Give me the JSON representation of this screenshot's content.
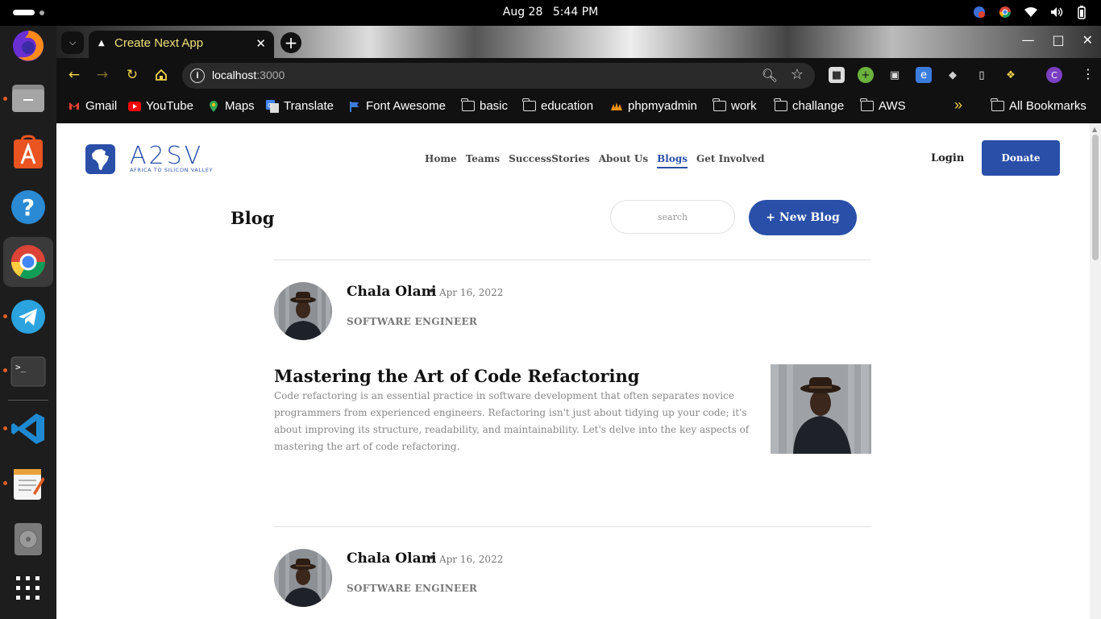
{
  "system": {
    "date": "Aug 28",
    "time": "5:44 PM"
  },
  "dock": {
    "apps": [
      {
        "name": "firefox",
        "running": false
      },
      {
        "name": "files",
        "running": true
      },
      {
        "name": "app-center",
        "running": false
      },
      {
        "name": "help",
        "running": false
      },
      {
        "name": "chrome",
        "running": true
      },
      {
        "name": "telegram",
        "running": true
      },
      {
        "name": "terminal",
        "running": true
      },
      {
        "name": "vscode",
        "running": true
      },
      {
        "name": "text-editor",
        "running": true
      },
      {
        "name": "disks",
        "running": false
      },
      {
        "name": "show-apps",
        "running": false
      }
    ]
  },
  "browser": {
    "tab_title": "Create Next App",
    "url_host": "localhost",
    "url_port": ":3000",
    "profile_initial": "C",
    "bookmarks": [
      {
        "label": "Gmail",
        "icon": "gmail-icon"
      },
      {
        "label": "YouTube",
        "icon": "youtube-icon"
      },
      {
        "label": "Maps",
        "icon": "maps-icon"
      },
      {
        "label": "Translate",
        "icon": "translate-icon"
      },
      {
        "label": "Font Awesome",
        "icon": "font-awesome-icon"
      },
      {
        "label": "basic",
        "icon": "folder-icon"
      },
      {
        "label": "education",
        "icon": "folder-icon"
      },
      {
        "label": "phpmyadmin",
        "icon": "phpmyadmin-icon"
      },
      {
        "label": "work",
        "icon": "folder-icon"
      },
      {
        "label": "challange",
        "icon": "folder-icon"
      },
      {
        "label": "AWS",
        "icon": "folder-icon"
      }
    ],
    "more_bookmarks": "»",
    "all_bookmarks": "All Bookmarks"
  },
  "site": {
    "logo_text": "A2SV",
    "logo_subtitle": "AFRICA TO SILICON VALLEY",
    "nav": [
      "Home",
      "Teams",
      "SuccessStories",
      "About Us",
      "Blogs",
      "Get Involved"
    ],
    "active_nav": "Blogs",
    "login_label": "Login",
    "donate_label": "Donate",
    "accent_color": "#2a4fa8"
  },
  "blog": {
    "heading": "Blog",
    "search_placeholder": "search",
    "new_blog_label": "+ New Blog",
    "posts": [
      {
        "author": "Chala Olani",
        "date": "Apr 16, 2022",
        "role": "SOFTWARE ENGINEER",
        "title": "Mastering the Art of Code Refactoring",
        "excerpt": "Code refactoring is an essential practice in software development that often separates novice programmers from experienced engineers. Refactoring isn't just about tidying up your code; it's about improving its structure, readability, and maintainability. Let's delve into the key aspects of mastering the art of code refactoring."
      },
      {
        "author": "Chala Olani",
        "date": "Apr 16, 2022",
        "role": "SOFTWARE ENGINEER"
      }
    ]
  }
}
